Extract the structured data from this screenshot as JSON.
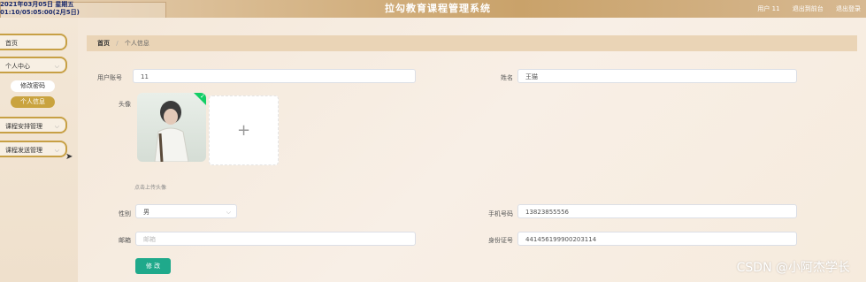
{
  "header": {
    "clock_line1": "2021年03月05日 星期五",
    "clock_line2": "01:10/05:05:00(2月5日)",
    "title": "拉勾教育课程管理系统",
    "user": "用户 11",
    "backend_link": "退出到前台",
    "logout_link": "退出登录"
  },
  "sidebar": {
    "home": "首页",
    "personal_center": "个人中心",
    "change_password": "修改密码",
    "personal_info": "个人信息",
    "course_arrangement": "课程安排管理",
    "course_publish": "课程发送管理"
  },
  "breadcrumb": {
    "home": "首页",
    "sep": "/",
    "current": "个人信息"
  },
  "form": {
    "account_label": "用户账号",
    "account_value": "11",
    "name_label": "姓名",
    "name_value": "王猫",
    "avatar_label": "头像",
    "upload_plus": "+",
    "upload_hint": "点击上传头像",
    "gender_label": "性别",
    "gender_value": "男",
    "phone_label": "手机号码",
    "phone_value": "13823855556",
    "email_label": "邮箱",
    "email_placeholder": "邮箱",
    "idcard_label": "身份证号",
    "idcard_value": "441456199900203114",
    "submit": "修 改"
  },
  "watermark": "CSDN @小阿杰学长",
  "colors": {
    "accent": "#c9a33f",
    "submit": "#1fa98b"
  }
}
